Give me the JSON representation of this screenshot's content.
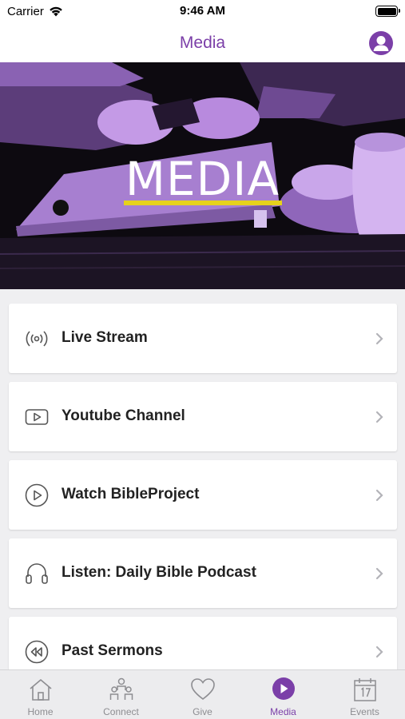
{
  "status_bar": {
    "carrier": "Carrier",
    "time": "9:46 AM"
  },
  "nav": {
    "title": "Media",
    "profile_icon": "person-icon"
  },
  "hero": {
    "title": "MEDIA",
    "underline_color": "#e6d21c",
    "tint_color": "#a878d6"
  },
  "menu": {
    "items": [
      {
        "label": "Live Stream",
        "icon": "broadcast-icon"
      },
      {
        "label": "Youtube Channel",
        "icon": "youtube-icon"
      },
      {
        "label": "Watch BibleProject",
        "icon": "play-circle-icon"
      },
      {
        "label": "Listen: Daily Bible Podcast",
        "icon": "headphones-icon"
      },
      {
        "label": "Past Sermons",
        "icon": "rewind-icon"
      }
    ]
  },
  "tabs": [
    {
      "label": "Home",
      "icon": "home-icon",
      "active": false
    },
    {
      "label": "Connect",
      "icon": "people-icon",
      "active": false
    },
    {
      "label": "Give",
      "icon": "heart-icon",
      "active": false
    },
    {
      "label": "Media",
      "icon": "play-icon",
      "active": true
    },
    {
      "label": "Events",
      "icon": "calendar-icon",
      "active": false
    }
  ],
  "colors": {
    "accent": "#7b3fa8",
    "tab_inactive": "#8d8d91",
    "background": "#efeff1"
  }
}
